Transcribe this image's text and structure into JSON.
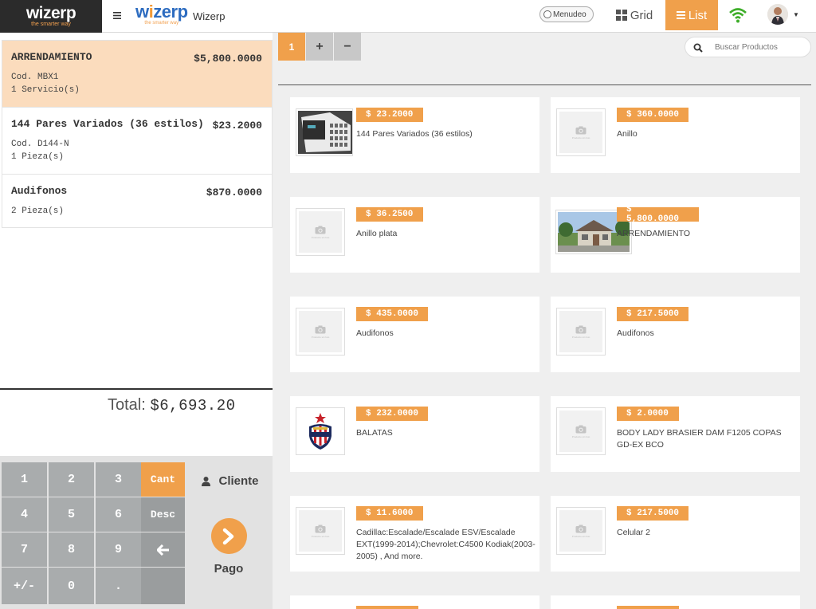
{
  "header": {
    "brand": "wizerp",
    "brand_tagline": "the smarter way",
    "logo_text": "wizerp",
    "logo_tagline": "the smarter way",
    "app_name": "Wizerp",
    "menudeo_label": "Menudeo",
    "grid_label": "Grid",
    "list_label": "List"
  },
  "cart": {
    "items": [
      {
        "name": "ARRENDAMIENTO",
        "price": "$5,800.0000",
        "code": "Cod. MBX1",
        "qty": "1 Servicio(s)"
      },
      {
        "name": "144 Pares Variados (36 estilos)",
        "price": "$23.2000",
        "code": "Cod. D144-N",
        "qty": "1 Pieza(s)"
      },
      {
        "name": "Audifonos",
        "price": "$870.0000",
        "qty": "2 Pieza(s)"
      }
    ],
    "total_label": "Total:",
    "total_value": "$6,693.20"
  },
  "keypad": {
    "k1": "1",
    "k2": "2",
    "k3": "3",
    "k4": "4",
    "k5": "5",
    "k6": "6",
    "k7": "7",
    "k8": "8",
    "k9": "9",
    "kpm": "+/-",
    "k0": "0",
    "kdot": ".",
    "cant": "Cant",
    "desc": "Desc",
    "cliente": "Cliente",
    "pago": "Pago"
  },
  "tabs": {
    "current": "1",
    "add": "+",
    "remove": "−"
  },
  "search": {
    "placeholder": "Buscar Productos"
  },
  "products": [
    {
      "price": "$ 23.2000",
      "name": "144 Pares Variados (36 estilos)",
      "image": "catalog-photo"
    },
    {
      "price": "$ 360.0000",
      "name": "Anillo",
      "image": "placeholder"
    },
    {
      "price": "$ 36.2500",
      "name": "Anillo plata",
      "image": "placeholder"
    },
    {
      "price": "$ 5,800.0000",
      "name": "ARRENDAMIENTO",
      "image": "house-photo"
    },
    {
      "price": "$ 435.0000",
      "name": "Audifonos",
      "image": "placeholder"
    },
    {
      "price": "$ 217.5000",
      "name": "Audifonos",
      "image": "placeholder"
    },
    {
      "price": "$ 232.0000",
      "name": "BALATAS",
      "image": "club-crest"
    },
    {
      "price": "$ 2.0000",
      "name": "BODY LADY BRASIER DAM F1205 COPAS GD-EX BCO",
      "image": "placeholder"
    },
    {
      "price": "$ 11.6000",
      "name": "Cadillac:Escalade/Escalade ESV/Escalade EXT(1999-2014);Chevrolet:C4500 Kodiak(2003-2005) , And more.",
      "image": "placeholder"
    },
    {
      "price": "$ 217.5000",
      "name": "Celular 2",
      "image": "placeholder"
    }
  ],
  "colors": {
    "accent": "#f0a04b",
    "active_row": "#fbdcbd",
    "key_gray": "#a9acad",
    "brand_blue": "#2d6cc0"
  }
}
